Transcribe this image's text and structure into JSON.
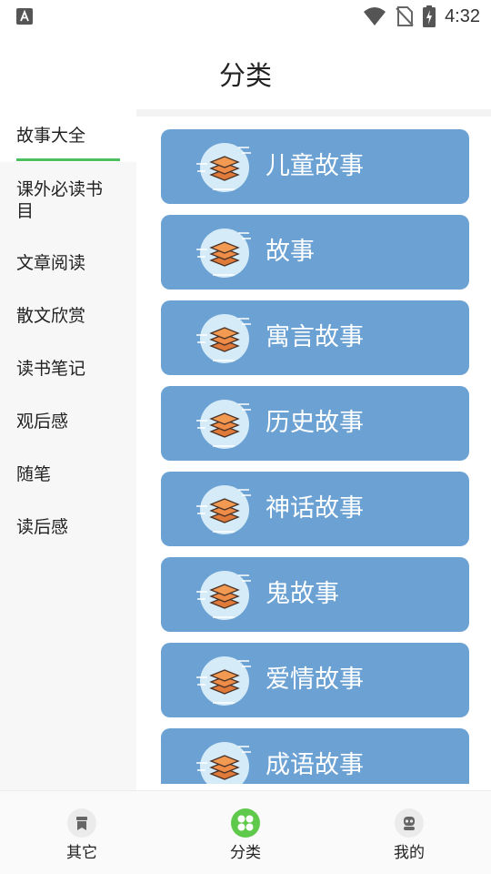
{
  "status_bar": {
    "time": "4:32",
    "icons": [
      "a-icon",
      "wifi-icon",
      "no-sim-icon",
      "battery-charging-icon"
    ]
  },
  "header": {
    "title": "分类"
  },
  "sidebar": {
    "items": [
      {
        "label": "故事大全",
        "active": true
      },
      {
        "label": "课外必读书目",
        "active": false
      },
      {
        "label": "文章阅读",
        "active": false
      },
      {
        "label": "散文欣赏",
        "active": false
      },
      {
        "label": "读书笔记",
        "active": false
      },
      {
        "label": "观后感",
        "active": false
      },
      {
        "label": "随笔",
        "active": false
      },
      {
        "label": "读后感",
        "active": false
      }
    ],
    "accent": "#4cbf5f"
  },
  "categories": [
    {
      "label": "儿童故事",
      "icon": "layers-icon"
    },
    {
      "label": "故事",
      "icon": "layers-icon"
    },
    {
      "label": "寓言故事",
      "icon": "layers-icon"
    },
    {
      "label": "历史故事",
      "icon": "layers-icon"
    },
    {
      "label": "神话故事",
      "icon": "layers-icon"
    },
    {
      "label": "鬼故事",
      "icon": "layers-icon"
    },
    {
      "label": "爱情故事",
      "icon": "layers-icon"
    },
    {
      "label": "成语故事",
      "icon": "layers-icon"
    }
  ],
  "card_color": "#6ba2d3",
  "bottom_nav": [
    {
      "label": "其它",
      "icon": "bookmark-icon",
      "active": false
    },
    {
      "label": "分类",
      "icon": "grid-icon",
      "active": true
    },
    {
      "label": "我的",
      "icon": "robot-icon",
      "active": false
    }
  ]
}
